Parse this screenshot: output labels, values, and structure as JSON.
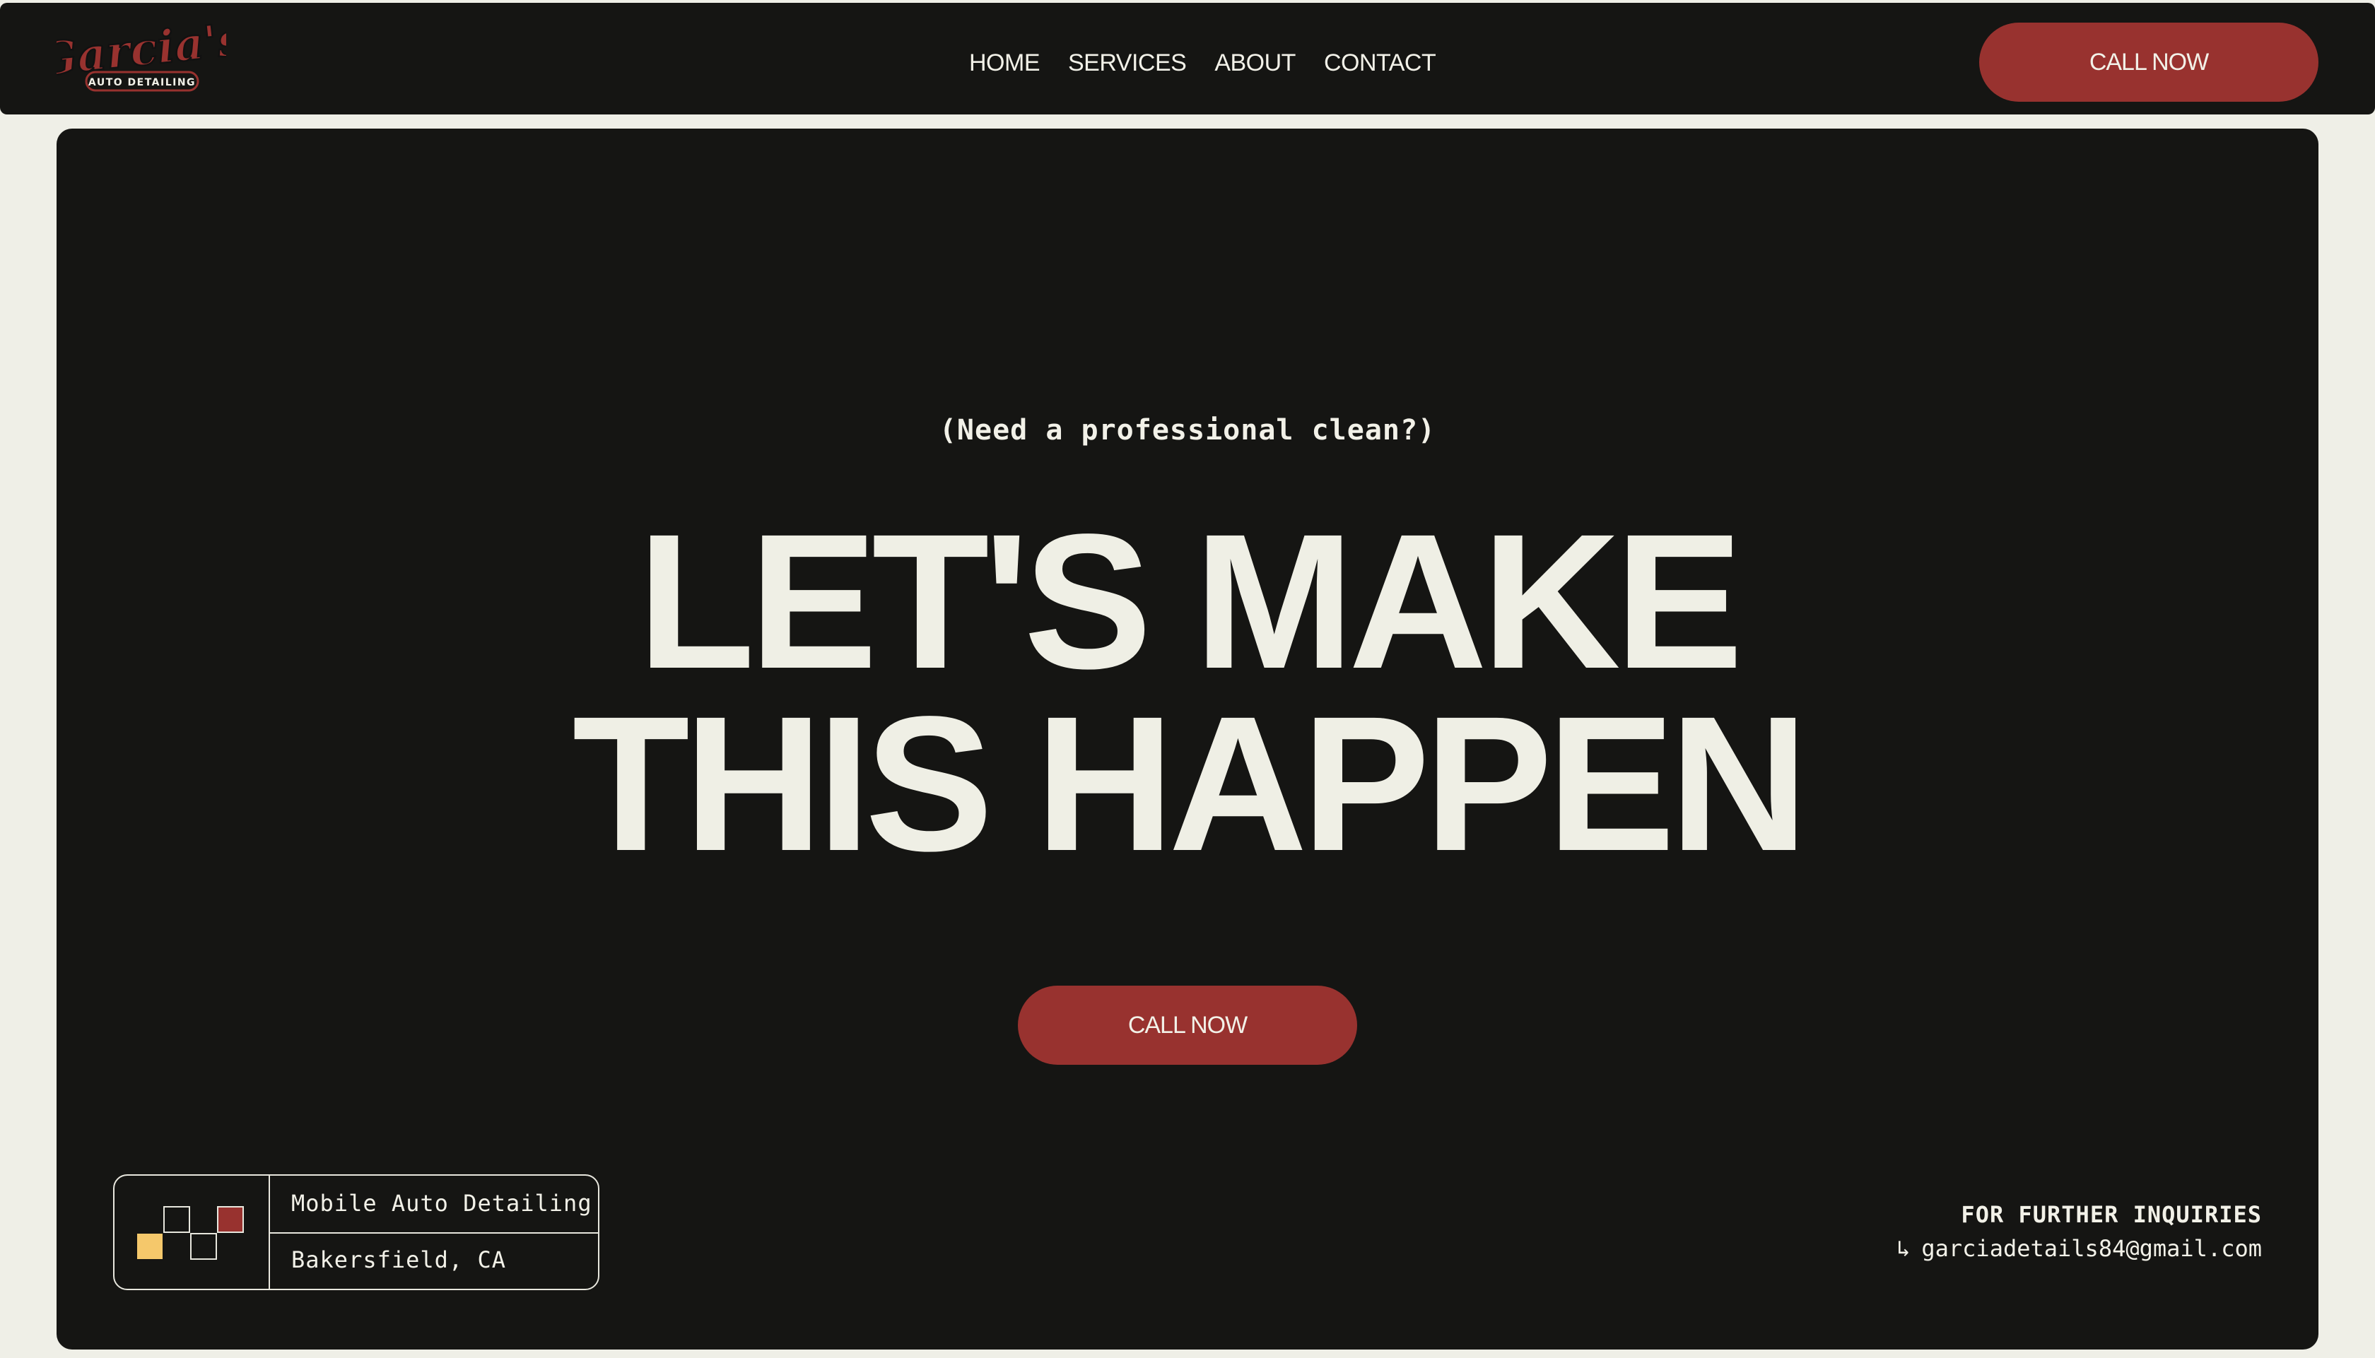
{
  "nav": {
    "logo_text": "Garcia's",
    "logo_subtext": "AUTO DETAILING",
    "links": [
      {
        "label": "HOME"
      },
      {
        "label": "SERVICES"
      },
      {
        "label": "ABOUT"
      },
      {
        "label": "CONTACT"
      }
    ],
    "cta_label": "CALL NOW"
  },
  "hero": {
    "tagline": "(Need a professional clean?)",
    "headline_line1": "LET'S MAKE",
    "headline_line2": "THIS HAPPEN",
    "cta_label": "CALL NOW"
  },
  "info_card": {
    "service": "Mobile Auto Detailing",
    "location": "Bakersfield, CA"
  },
  "inquiries": {
    "heading": "FOR FURTHER INQUIRIES",
    "arrow": "↳",
    "email": "garciadetails84@gmail.com"
  },
  "colors": {
    "dark": "#151513",
    "cream": "#efefe7",
    "brand_red": "#98322f",
    "yellow": "#f5c86b"
  }
}
